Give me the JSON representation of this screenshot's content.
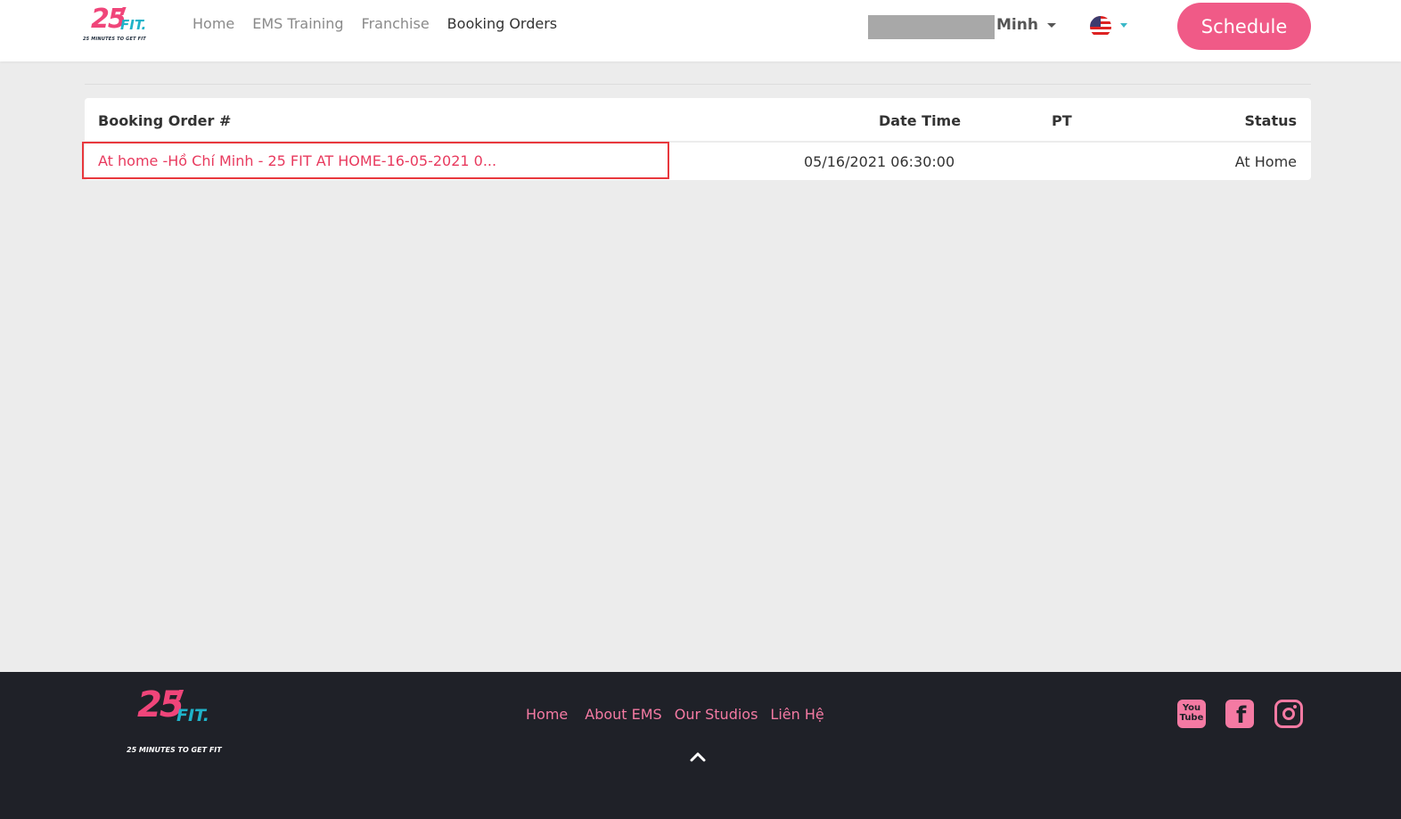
{
  "brand": {
    "logo_number": "25",
    "logo_word": "FIT.",
    "logo_tagline": "25 MINUTES TO GET FIT",
    "accent_color": "#f05a87",
    "teal_color": "#1fb3c9"
  },
  "header": {
    "nav": [
      {
        "label": "Home",
        "active": false
      },
      {
        "label": "EMS Training",
        "active": false
      },
      {
        "label": "Franchise",
        "active": false
      },
      {
        "label": "Booking Orders",
        "active": true
      }
    ],
    "user_name": "Minh",
    "language_flag": "us-flag-icon",
    "schedule_label": "Schedule"
  },
  "table": {
    "headers": {
      "order": "Booking Order #",
      "datetime": "Date Time",
      "pt": "PT",
      "status": "Status"
    },
    "rows": [
      {
        "order": "At home -Hồ Chí Minh - 25 FIT AT HOME-16-05-2021 0...",
        "datetime": "05/16/2021 06:30:00",
        "pt": "",
        "status": "At Home"
      }
    ]
  },
  "footer": {
    "logo_number": "25",
    "logo_word": "FIT.",
    "logo_tagline": "25 MINUTES TO GET FIT",
    "nav": [
      "Home",
      "About EMS",
      "Our Studios",
      "Liên Hệ"
    ],
    "youtube_label": "You Tube",
    "facebook_label": "f",
    "social_icons": [
      "youtube-icon",
      "facebook-icon",
      "instagram-icon"
    ]
  }
}
